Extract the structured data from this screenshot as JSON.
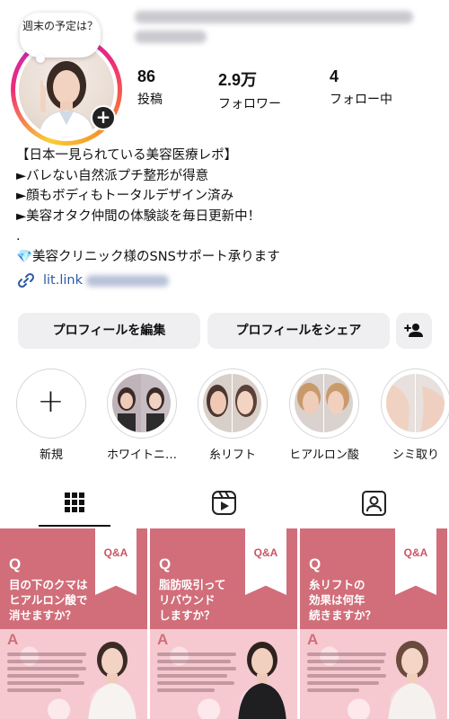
{
  "profile": {
    "note": "週末の予定は？",
    "add_story_symbol": "+",
    "stats": [
      {
        "value": "86",
        "label": "投稿"
      },
      {
        "value": "2.9万",
        "label": "フォロワー"
      },
      {
        "value": "4",
        "label": "フォロー中"
      }
    ]
  },
  "bio": {
    "lines": [
      "【日本一見られている美容医療レポ】",
      "►バレない自然派プチ整形が得意",
      "►顔もボディもトータルデザイン済み",
      "►美容オタク仲間の体験談を毎日更新中！",
      ".",
      "💎美容クリニック様のSNSサポート承ります"
    ],
    "link": "lit.link"
  },
  "buttons": {
    "edit": "プロフィールを編集",
    "share": "プロフィールをシェア"
  },
  "highlights": {
    "new_symbol": "+",
    "items": [
      {
        "label": "新規"
      },
      {
        "label": "ホワイトニ…"
      },
      {
        "label": "糸リフト"
      },
      {
        "label": "ヒアルロン酸"
      },
      {
        "label": "シミ取り"
      }
    ]
  },
  "tabs": {
    "active": "posts-grid",
    "items": [
      "grid-icon",
      "reels-icon",
      "tagged-icon"
    ]
  },
  "posts": [
    {
      "q": "Q",
      "title": "目の下のクマは\nヒアルロン酸で\n消せますか？",
      "badge": "Q&A",
      "a": "A"
    },
    {
      "q": "Q",
      "title": "脂肪吸引って\nリバウンド\nしますか？",
      "badge": "Q&A",
      "a": "A"
    },
    {
      "q": "Q",
      "title": "糸リフトの\n効果は何年\n続きますか？",
      "badge": "Q&A",
      "a": "A"
    }
  ],
  "colors": {
    "accent_pink": "#d16e7a",
    "link_blue": "#2b5aa7",
    "button_bg": "#efeff2"
  }
}
